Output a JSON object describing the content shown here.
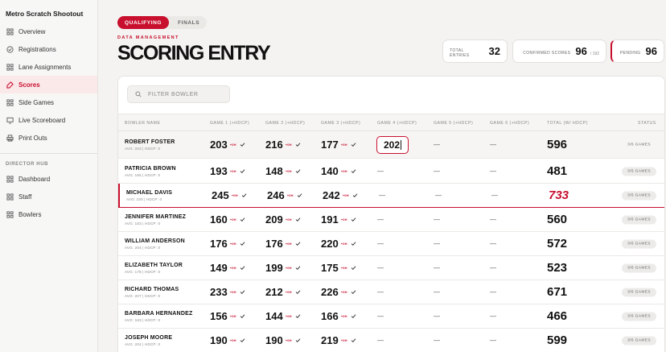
{
  "app": {
    "title": "Metro Scratch Shootout"
  },
  "sidebar": {
    "items": [
      {
        "label": "Overview",
        "icon": "grid-icon"
      },
      {
        "label": "Registrations",
        "icon": "check-circle-icon"
      },
      {
        "label": "Lane Assignments",
        "icon": "grid-icon"
      },
      {
        "label": "Scores",
        "icon": "edit-icon",
        "active": true
      },
      {
        "label": "Side Games",
        "icon": "grid-icon"
      },
      {
        "label": "Live Scoreboard",
        "icon": "monitor-icon"
      },
      {
        "label": "Print Outs",
        "icon": "printer-icon"
      }
    ],
    "section_label": "DIRECTOR HUB",
    "hub_items": [
      {
        "label": "Dashboard",
        "icon": "grid-icon"
      },
      {
        "label": "Staff",
        "icon": "grid-icon"
      },
      {
        "label": "Bowlers",
        "icon": "grid-icon"
      }
    ]
  },
  "tabs": [
    {
      "label": "QUALIFYING",
      "active": true
    },
    {
      "label": "FINALS",
      "active": false
    }
  ],
  "header": {
    "kicker": "DATA MANAGEMENT",
    "title": "SCORING ENTRY"
  },
  "stats": {
    "total_entries": {
      "label": "TOTAL ENTRIES",
      "value": "32"
    },
    "confirmed": {
      "label": "CONFIRMED SCORES",
      "value": "96",
      "sub": "/ 192"
    },
    "pending": {
      "label": "PENDING",
      "value": "96"
    }
  },
  "filter": {
    "placeholder": "FILTER BOWLER"
  },
  "table": {
    "columns": [
      "BOWLER NAME",
      "GAME 1 (+HDCP)",
      "GAME 2 (+HDCP)",
      "GAME 3 (+HDCP)",
      "GAME 4 (+HDCP)",
      "GAME 5 (+HDCP)",
      "GAME 6 (+HDCP)",
      "TOTAL (W/ HDCP)",
      "STATUS"
    ],
    "hdcp_tag": "+0H",
    "dash": "—",
    "editing_value": "202",
    "rows": [
      {
        "name": "ROBERT FOSTER",
        "sub": "AVG: 203 | HDCP: 0",
        "g1": "203",
        "g2": "216",
        "g3": "177",
        "total": "596",
        "status": "3/6 GAMES"
      },
      {
        "name": "PATRICIA BROWN",
        "sub": "AVG: 165 | HDCP: 0",
        "g1": "193",
        "g2": "148",
        "g3": "140",
        "total": "481",
        "status": "3/6 GAMES"
      },
      {
        "name": "MICHAEL DAVIS",
        "sub": "AVG: 230 | HDCP: 0",
        "g1": "245",
        "g2": "246",
        "g3": "242",
        "total": "733",
        "status": "3/6 GAMES",
        "flag": true
      },
      {
        "name": "JENNIFER MARTINEZ",
        "sub": "AVG: 183 | HDCP: 0",
        "g1": "160",
        "g2": "209",
        "g3": "191",
        "total": "560",
        "status": "3/6 GAMES"
      },
      {
        "name": "WILLIAM ANDERSON",
        "sub": "AVG: 204 | HDCP: 0",
        "g1": "176",
        "g2": "176",
        "g3": "220",
        "total": "572",
        "status": "3/6 GAMES"
      },
      {
        "name": "ELIZABETH TAYLOR",
        "sub": "AVG: 178 | HDCP: 0",
        "g1": "149",
        "g2": "199",
        "g3": "175",
        "total": "523",
        "status": "3/6 GAMES"
      },
      {
        "name": "RICHARD THOMAS",
        "sub": "AVG: 207 | HDCP: 0",
        "g1": "233",
        "g2": "212",
        "g3": "226",
        "total": "671",
        "status": "3/6 GAMES"
      },
      {
        "name": "BARBARA HERNANDEZ",
        "sub": "AVG: 163 | HDCP: 0",
        "g1": "156",
        "g2": "144",
        "g3": "166",
        "total": "466",
        "status": "3/6 GAMES"
      },
      {
        "name": "JOSEPH MOORE",
        "sub": "AVG: 204 | HDCP: 0",
        "g1": "190",
        "g2": "190",
        "g3": "219",
        "total": "599",
        "status": "3/6 GAMES"
      }
    ]
  },
  "colors": {
    "accent": "#c8102e",
    "background": "#f4f3f1",
    "card": "#ffffff"
  }
}
